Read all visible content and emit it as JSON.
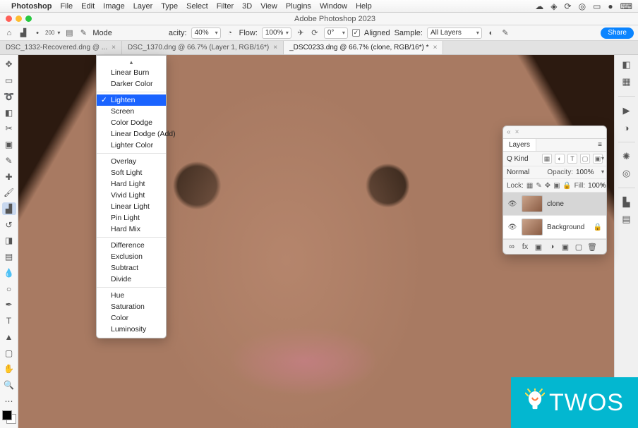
{
  "macMenu": {
    "appName": "Photoshop",
    "items": [
      "File",
      "Edit",
      "Image",
      "Layer",
      "Type",
      "Select",
      "Filter",
      "3D",
      "View",
      "Plugins",
      "Window",
      "Help"
    ]
  },
  "titlebar": {
    "title": "Adobe Photoshop 2023"
  },
  "optionsBar": {
    "brushSize": "200",
    "modeLabel": "Mode",
    "opacityLabel": "acity:",
    "opacityValue": "40%",
    "flowLabel": "Flow:",
    "flowValue": "100%",
    "angleIcon": "⟳",
    "angleValue": "0°",
    "alignedLabel": "Aligned",
    "alignedChecked": true,
    "sampleLabel": "Sample:",
    "sampleValue": "All Layers",
    "shareLabel": "Share"
  },
  "tabs": [
    {
      "label": "DSC_1332-Recovered.dng @ ...",
      "active": false
    },
    {
      "label": "DSC_1370.dng @ 66.7% (Layer 1, RGB/16*)",
      "active": false
    },
    {
      "label": "_DSC0233.dng @ 66.7% (clone, RGB/16*) *",
      "active": true
    }
  ],
  "blendModeMenu": {
    "selected": "Lighten",
    "groups": [
      [
        "Linear Burn",
        "Darker Color"
      ],
      [
        "Lighten",
        "Screen",
        "Color Dodge",
        "Linear Dodge (Add)",
        "Lighter Color"
      ],
      [
        "Overlay",
        "Soft Light",
        "Hard Light",
        "Vivid Light",
        "Linear Light",
        "Pin Light",
        "Hard Mix"
      ],
      [
        "Difference",
        "Exclusion",
        "Subtract",
        "Divide"
      ],
      [
        "Hue",
        "Saturation",
        "Color",
        "Luminosity"
      ]
    ]
  },
  "layersPanel": {
    "title": "Layers",
    "kind": "Q Kind",
    "blend": "Normal",
    "opacityLabel": "Opacity:",
    "opacityValue": "100%",
    "lockLabel": "Lock:",
    "fillLabel": "Fill:",
    "fillValue": "100%",
    "layers": [
      {
        "name": "clone",
        "visible": true,
        "locked": false,
        "selected": true
      },
      {
        "name": "Background",
        "visible": true,
        "locked": true,
        "selected": false
      }
    ]
  },
  "overlay": {
    "twos": "TWOS"
  }
}
